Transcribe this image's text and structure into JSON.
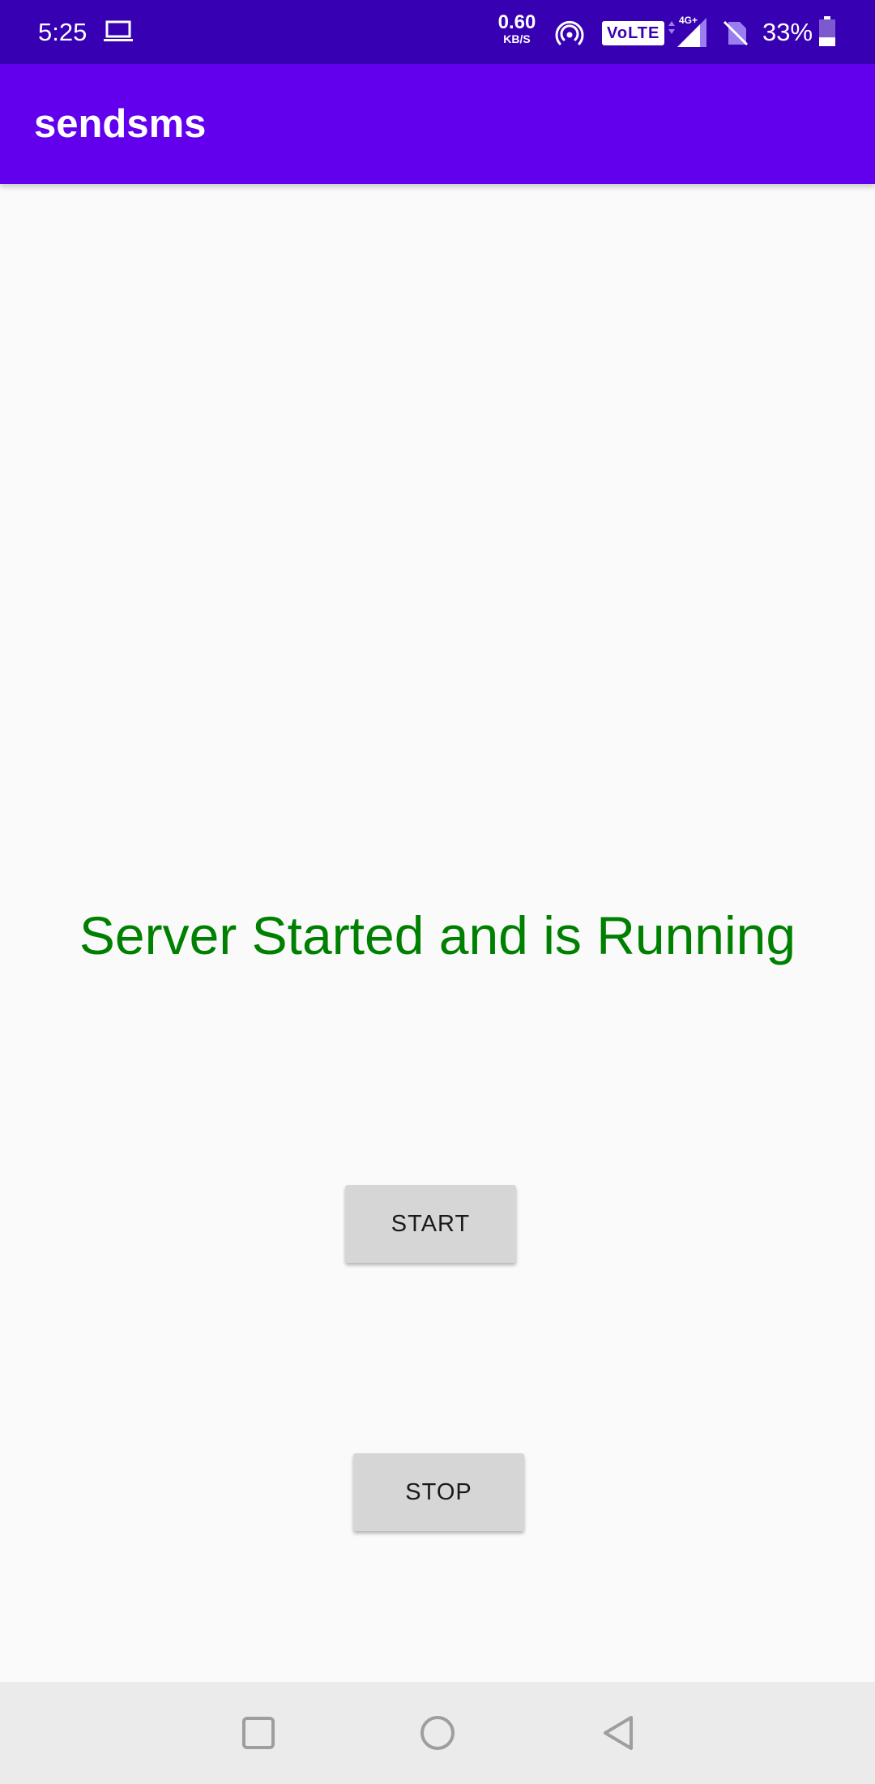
{
  "status_bar": {
    "time": "5:25",
    "net_speed_value": "0.60",
    "net_speed_unit": "KB/S",
    "volte": "VoLTE",
    "network": "4G+",
    "battery_percent": "33%",
    "battery_level": 0.33,
    "icons": [
      "laptop-icon",
      "hotspot-icon",
      "signal-icon",
      "no-sim-icon",
      "battery-icon"
    ]
  },
  "app_bar": {
    "title": "sendsms"
  },
  "main": {
    "status_text": "Server Started and is Running",
    "status_color": "#008000",
    "start_label": "START",
    "stop_label": "STOP"
  },
  "nav_bar": {
    "icons": [
      "recents-icon",
      "home-icon",
      "back-icon"
    ]
  },
  "colors": {
    "status_bar": "#3700b3",
    "app_bar": "#6200ee",
    "background": "#fafafa",
    "button": "#d6d6d6",
    "nav_bar": "#ebebeb"
  }
}
